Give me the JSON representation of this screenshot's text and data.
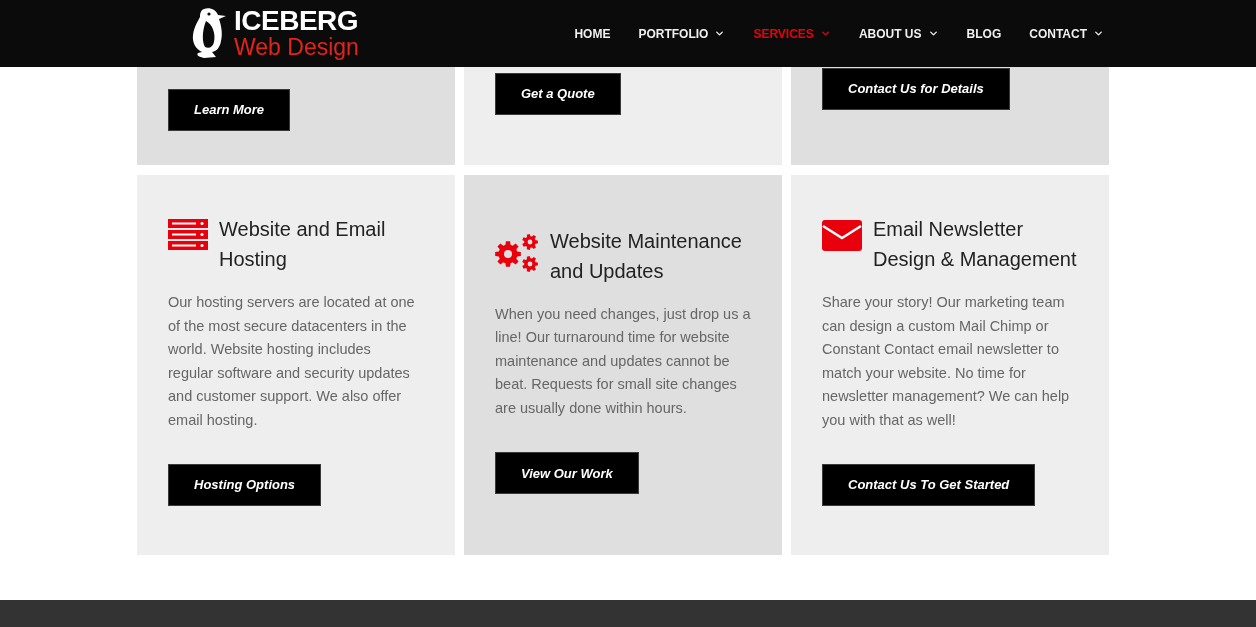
{
  "header": {
    "logo": {
      "title": "ICEBERG",
      "subtitle": "Web Design"
    },
    "nav": [
      {
        "label": "HOME",
        "selected": false,
        "dropdown": false
      },
      {
        "label": "PORTFOLIO",
        "selected": false,
        "dropdown": true
      },
      {
        "label": "SERVICES",
        "selected": true,
        "dropdown": true
      },
      {
        "label": "ABOUT US",
        "selected": false,
        "dropdown": true
      },
      {
        "label": "BLOG",
        "selected": false,
        "dropdown": false
      },
      {
        "label": "CONTACT",
        "selected": false,
        "dropdown": true
      }
    ]
  },
  "top_cards": [
    {
      "button": "Learn More"
    },
    {
      "button": "Get a Quote"
    },
    {
      "button": "Contact Us for Details"
    }
  ],
  "service_cards": [
    {
      "kind": "server",
      "title": "Website and Email Hosting",
      "text": "Our hosting servers are located at one of the most secure datacenters in the world. Website hosting includes regular software and security updates and customer support. We also offer email hosting.",
      "button": "Hosting Options"
    },
    {
      "kind": "gears",
      "title": "Website Maintenance and Updates",
      "text": "When you need changes, just drop us a line! Our turnaround time for website maintenance and updates cannot be beat. Requests for small site changes are usually done within hours.",
      "button": "View Our Work"
    },
    {
      "kind": "envelope",
      "title": "Email Newsletter Design & Management",
      "text": "Share your story! Our marketing team can design a custom Mail Chimp or Constant Contact email newsletter to match your website. No time for newsletter management? We can help you with that as well!",
      "button": "Contact Us To Get Started"
    }
  ]
}
